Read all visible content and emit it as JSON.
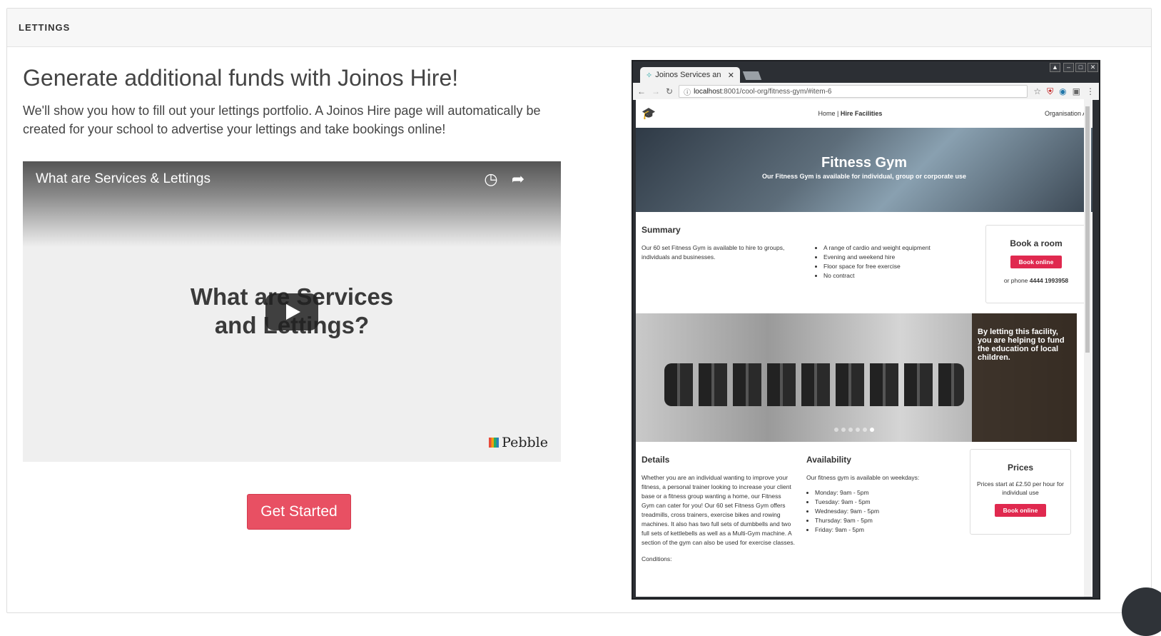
{
  "panel": {
    "heading": "LETTINGS"
  },
  "intro": {
    "headline": "Generate additional funds with Joinos Hire!",
    "lead": "We'll show you how to fill out your lettings portfolio. A Joinos Hire page will automatically be created for your school to advertise your lettings and take bookings online!"
  },
  "video": {
    "title": "What are Services & Lettings",
    "center_line1": "What are Services",
    "center_line2": "and Lettings?",
    "brand": "Pebble"
  },
  "cta": {
    "label": "Get Started"
  },
  "browser": {
    "tab_title": "Joinos Services an",
    "url_host": "localhost",
    "url_path": ":8001/cool-org/fitness-gym/#item-6",
    "site": {
      "nav_home": "Home",
      "nav_sep": "|",
      "nav_active": "Hire Facilities",
      "org": "Organisation A",
      "hero_title": "Fitness Gym",
      "hero_subtitle": "Our Fitness Gym is available for individual, group or corporate use",
      "summary_heading": "Summary",
      "summary_text": "Our 60 set Fitness Gym is available to hire to groups, individuals and businesses.",
      "features": [
        "A range of cardio and weight equipment",
        "Evening and weekend hire",
        "Floor space for free exercise",
        "No contract"
      ],
      "book_title": "Book a room",
      "book_btn": "Book online",
      "phone_prefix": "or phone",
      "phone": "4444 1993958",
      "banner_text": "By letting this facility, you are helping to fund the education of local children.",
      "details_heading": "Details",
      "details_text": "Whether you are an individual wanting to improve your fitness, a personal trainer looking to increase your client base or a fitness group wanting a home, our Fitness Gym can cater for you! Our 60 set Fitness Gym offers treadmills, cross trainers, exercise bikes and rowing machines. It also has two full sets of dumbbells and two full sets of kettlebells as well as a Multi-Gym machine. A section of the gym can also be used for exercise classes.",
      "conditions": "Conditions:",
      "availability_heading": "Availability",
      "availability_intro": "Our fitness gym is available on weekdays:",
      "hours": [
        "Monday: 9am - 5pm",
        "Tuesday: 9am - 5pm",
        "Wednesday: 9am - 5pm",
        "Thursday: 9am - 5pm",
        "Friday: 9am - 5pm"
      ],
      "prices_title": "Prices",
      "prices_text": "Prices start at £2.50 per hour for individual use",
      "prices_btn": "Book online"
    }
  },
  "icons": {
    "clock": "clock-icon",
    "share": "share-icon",
    "chat": "chat-icon"
  }
}
